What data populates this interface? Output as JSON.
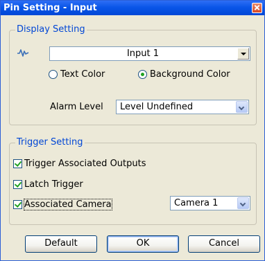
{
  "window": {
    "title": "Pin Setting - Input"
  },
  "display_setting": {
    "label": "Display Setting",
    "input_select": {
      "value": "Input 1"
    },
    "text_color_label": "Text Color",
    "background_color_label": "Background Color",
    "color_selected": "background",
    "alarm_level_label": "Alarm Level",
    "alarm_level_value": "Level Undefined"
  },
  "trigger_setting": {
    "label": "Trigger Setting",
    "trigger_associated_outputs": {
      "label": "Trigger Associated Outputs",
      "checked": true
    },
    "latch_trigger": {
      "label": "Latch Trigger",
      "checked": true
    },
    "associated_camera": {
      "label": "Associated Camera",
      "checked": true
    },
    "camera_value": "Camera 1"
  },
  "buttons": {
    "default": "Default",
    "ok": "OK",
    "cancel": "Cancel"
  },
  "colors": {
    "title_bar": "#0a56e8",
    "group_label": "#0046d5",
    "dialog_bg": "#ece9d8",
    "check_mark": "#21a121"
  }
}
